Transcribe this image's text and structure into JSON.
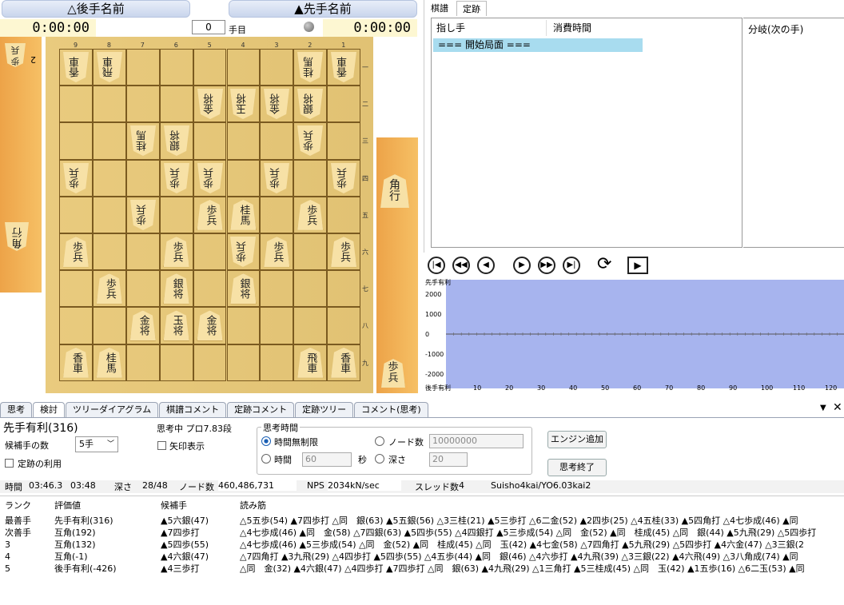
{
  "players": {
    "gote_name": "△後手名前",
    "sente_name": "▲先手名前",
    "gote_time": "0:00:00",
    "sente_time": "0:00:00",
    "move_number": "0",
    "move_label": "手目"
  },
  "hands": {
    "gote_count": "2"
  },
  "board": {
    "files": [
      "9",
      "8",
      "7",
      "6",
      "5",
      "4",
      "3",
      "2",
      "1"
    ],
    "ranks": [
      "一",
      "二",
      "三",
      "四",
      "五",
      "六",
      "七",
      "八",
      "九"
    ],
    "pieces": [
      {
        "r": 0,
        "c": 0,
        "t": "香車",
        "g": true
      },
      {
        "r": 0,
        "c": 1,
        "t": "飛車",
        "g": true
      },
      {
        "r": 0,
        "c": 7,
        "t": "桂馬",
        "g": true
      },
      {
        "r": 0,
        "c": 8,
        "t": "香車",
        "g": true
      },
      {
        "r": 1,
        "c": 4,
        "t": "金将",
        "g": true
      },
      {
        "r": 1,
        "c": 5,
        "t": "玉将",
        "g": true
      },
      {
        "r": 1,
        "c": 6,
        "t": "金将",
        "g": true
      },
      {
        "r": 1,
        "c": 7,
        "t": "銀将",
        "g": true
      },
      {
        "r": 2,
        "c": 2,
        "t": "桂馬",
        "g": true
      },
      {
        "r": 2,
        "c": 3,
        "t": "銀将",
        "g": true
      },
      {
        "r": 2,
        "c": 7,
        "t": "歩兵",
        "g": true
      },
      {
        "r": 3,
        "c": 0,
        "t": "歩兵",
        "g": true
      },
      {
        "r": 3,
        "c": 3,
        "t": "歩兵",
        "g": true
      },
      {
        "r": 3,
        "c": 4,
        "t": "歩兵",
        "g": true
      },
      {
        "r": 3,
        "c": 6,
        "t": "歩兵",
        "g": true
      },
      {
        "r": 3,
        "c": 8,
        "t": "歩兵",
        "g": true
      },
      {
        "r": 4,
        "c": 2,
        "t": "歩兵",
        "g": true
      },
      {
        "r": 4,
        "c": 4,
        "t": "歩兵",
        "g": false
      },
      {
        "r": 4,
        "c": 5,
        "t": "桂馬",
        "g": false
      },
      {
        "r": 4,
        "c": 7,
        "t": "歩兵",
        "g": false
      },
      {
        "r": 5,
        "c": 0,
        "t": "歩兵",
        "g": false
      },
      {
        "r": 5,
        "c": 3,
        "t": "歩兵",
        "g": false
      },
      {
        "r": 5,
        "c": 5,
        "t": "歩兵",
        "g": true
      },
      {
        "r": 5,
        "c": 6,
        "t": "歩兵",
        "g": false
      },
      {
        "r": 5,
        "c": 8,
        "t": "歩兵",
        "g": false
      },
      {
        "r": 6,
        "c": 1,
        "t": "歩兵",
        "g": false
      },
      {
        "r": 6,
        "c": 3,
        "t": "銀将",
        "g": false
      },
      {
        "r": 6,
        "c": 5,
        "t": "銀将",
        "g": false
      },
      {
        "r": 7,
        "c": 2,
        "t": "金将",
        "g": false
      },
      {
        "r": 7,
        "c": 3,
        "t": "玉将",
        "g": false
      },
      {
        "r": 7,
        "c": 4,
        "t": "金将",
        "g": false
      },
      {
        "r": 8,
        "c": 0,
        "t": "香車",
        "g": false
      },
      {
        "r": 8,
        "c": 1,
        "t": "桂馬",
        "g": false
      },
      {
        "r": 8,
        "c": 7,
        "t": "飛車",
        "g": false
      },
      {
        "r": 8,
        "c": 8,
        "t": "香車",
        "g": false
      }
    ]
  },
  "sente_hand": [
    {
      "t": "角行"
    },
    {
      "t": "歩兵"
    }
  ],
  "gote_hand": [
    {
      "t": "歩兵"
    },
    {
      "t": "角行"
    }
  ],
  "kifu": {
    "tab1": "棋譜",
    "tab2": "定跡",
    "col_move": "指し手",
    "col_time": "消費時間",
    "row0": "=== 開始局面 ===",
    "branch": "分岐(次の手)"
  },
  "graph": {
    "ylabel_top": "先手有利",
    "ylabel_bottom": "後手有利",
    "yticks": [
      "2000",
      "1000",
      "0",
      "-1000",
      "-2000"
    ],
    "xticks": [
      "10",
      "20",
      "30",
      "40",
      "50",
      "60",
      "70",
      "80",
      "90",
      "100",
      "110",
      "120"
    ],
    "bg": "#a7b4ee"
  },
  "tabs": [
    "思考",
    "検討",
    "ツリーダイアグラム",
    "棋譜コメント",
    "定跡コメント",
    "定跡ツリー",
    "コメント(思考)"
  ],
  "engine": {
    "eval_text": "先手有利(316)",
    "candidates_label": "候補手の数",
    "candidates_value": "5手",
    "use_joseki": "定跡の利用",
    "thinking": "思考中 プロ7.83段",
    "arrow_label": "矢印表示",
    "think_time_title": "思考時間",
    "unlimited": "時間無制限",
    "time_label": "時間",
    "time_value": "60",
    "sec": "秒",
    "nodes_label": "ノード数",
    "nodes_value": "10000000",
    "depth_label": "深さ",
    "depth_value": "20",
    "add_engine": "エンジン追加",
    "stop": "思考終了"
  },
  "status": {
    "time_label": "時間",
    "time": "03:46.3",
    "time2": "03:48",
    "depth_label": "深さ",
    "depth": "28/48",
    "nodes_label": "ノード数",
    "nodes": "460,486,731",
    "nps_label": "NPS",
    "nps": "2034kN/sec",
    "thread_label": "スレッド数",
    "threads": "4",
    "engine": "Suisho4kai/YO6.03kai2"
  },
  "pv_header": {
    "rank": "ランク",
    "eval": "評価値",
    "move": "候補手",
    "pv": "読み筋"
  },
  "pv_rows": [
    {
      "rank": "最善手",
      "eval": "先手有利(316)",
      "move": "▲5六銀(47)",
      "pv": "△5五歩(54) ▲7四歩打 △同　銀(63) ▲5五銀(56) △3三桂(21) ▲5三歩打 △6二金(52) ▲2四歩(25) △4五桂(33) ▲5四角打 △4七歩成(46) ▲同"
    },
    {
      "rank": "次善手",
      "eval": "互角(192)",
      "move": "▲7四歩打",
      "pv": "△4七歩成(46) ▲同　金(58) △7四銀(63) ▲5四歩(55) △4四銀打 ▲5三歩成(54) △同　金(52) ▲同　桂成(45) △同　銀(44) ▲5九飛(29) △5四歩打"
    },
    {
      "rank": "3",
      "eval": "互角(132)",
      "move": "▲5四歩(55)",
      "pv": "△4七歩成(46) ▲5三歩成(54) △同　金(52) ▲同　桂成(45) △同　玉(42) ▲4七金(58) △7四角打 ▲5九飛(29) △5四歩打 ▲4六金(47) △3三銀(2"
    },
    {
      "rank": "4",
      "eval": "互角(-1)",
      "move": "▲4六銀(47)",
      "pv": "△7四角打 ▲3九飛(29) △4四歩打 ▲5四歩(55) △4五歩(44) ▲同　銀(46) △4六歩打 ▲4九飛(39) △3三銀(22) ▲4六飛(49) △3八角成(74) ▲同"
    },
    {
      "rank": "5",
      "eval": "後手有利(-426)",
      "move": "▲4三歩打",
      "pv": "△同　金(32) ▲4六銀(47) △4四歩打 ▲7四歩打 △同　銀(63) ▲4九飛(29) △1三角打 ▲5三桂成(45) △同　玉(42) ▲1五歩(16) △6二玉(53) ▲同"
    }
  ]
}
